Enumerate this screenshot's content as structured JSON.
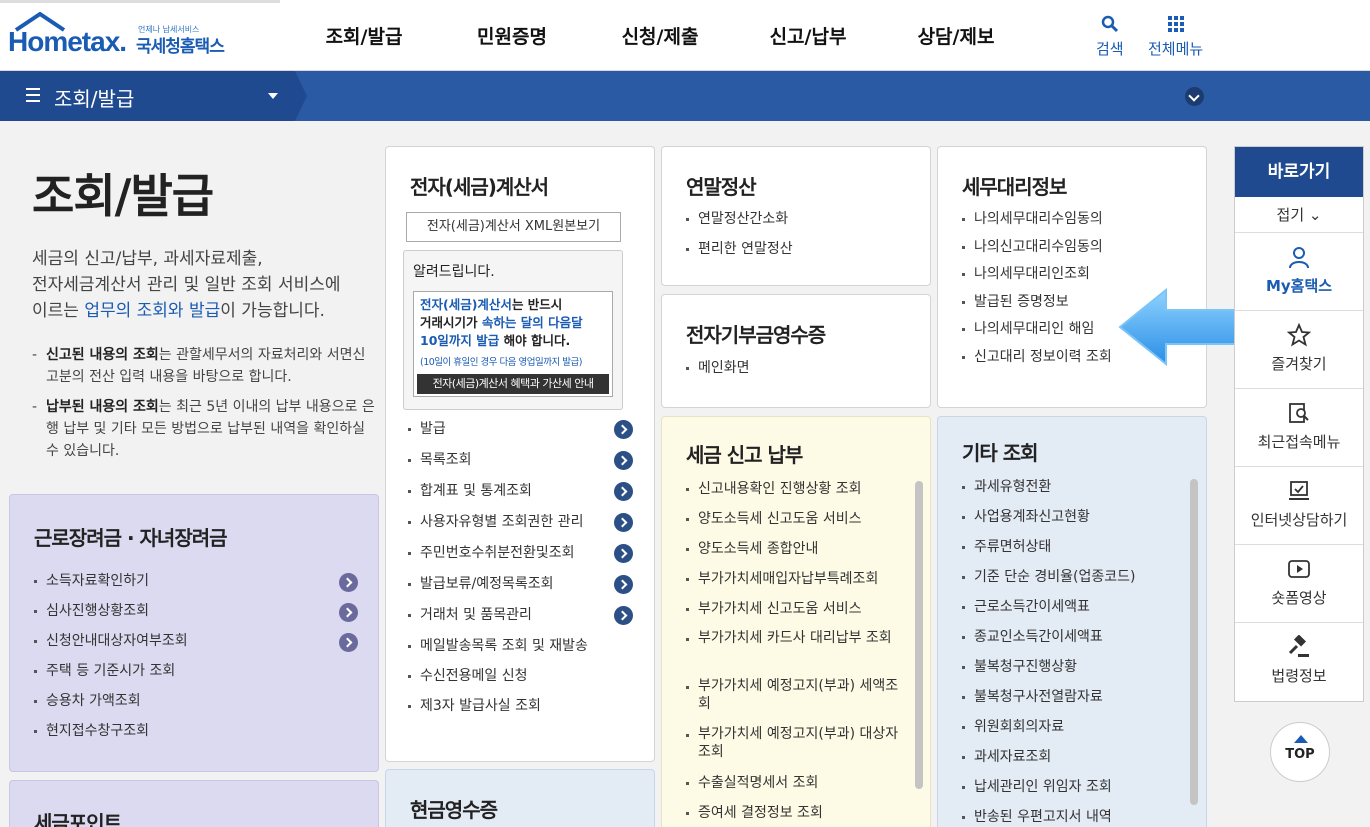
{
  "header": {
    "logo_main": "Hometax.",
    "logo_sub": "국세청홈택스",
    "logo_small": "언제나 납세서비스",
    "nav": [
      "조회/발급",
      "민원증명",
      "신청/제출",
      "신고/납부",
      "상담/제보"
    ],
    "search_label": "검색",
    "allmenu_label": "전체메뉴"
  },
  "bar": {
    "title": "조회/발급"
  },
  "intro": {
    "title": "조회/발급",
    "desc_1": "세금의 신고/납부, 과세자료제출,",
    "desc_2": "전자세금계산서 관리 및 일반 조회 서비스에",
    "desc_3_pre": "이르는 ",
    "desc_3_hl": "업무의 조회와 발급",
    "desc_3_post": "이 가능합니다.",
    "note1_b": "신고된 내용의 조회",
    "note1_t": "는 관할세무서의 자료처리와 서면신고분의 전산 입력 내용을 바탕으로 합니다.",
    "note2_b": "납부된 내용의 조회",
    "note2_t": "는 최근 5년 이내의 납부 내용으로 은행 납부 및 기타 모든 방법으로 납부된 내역을 확인하실 수 있습니다."
  },
  "card_incentive": {
    "title": "근로장려금 · 자녀장려금",
    "items": [
      "소득자료확인하기",
      "심사진행상황조회",
      "신청안내대상자여부조회",
      "주택 등 기준시가 조회",
      "승용차 가액조회",
      "현지접수창구조회"
    ]
  },
  "card_points": {
    "title": "세금포인트"
  },
  "card_einvoice": {
    "title": "전자(세금)계산서",
    "xml_button": "전자(세금)계산서 XML원본보기",
    "notice_title": "알려드립니다.",
    "notice_l1a": "전자(세금)계산서",
    "notice_l1b": "는 반드시",
    "notice_l2a": "거래시기가 ",
    "notice_l2b": "속하는 달의 다음달",
    "notice_l3a": "10일까지 발급",
    "notice_l3b": " 해야 합니다.",
    "notice_small": "(10일이 휴일인 경우 다음 영업일까지 발급)",
    "notice_bar": "전자(세금)계산서 혜택과 가산세 안내",
    "items": [
      "발급",
      "목록조회",
      "합계표 및 통계조회",
      "사용자유형별 조회권한 관리",
      "주민번호수취분전환및조회",
      "발급보류/예정목록조회",
      "거래처 및 품목관리",
      "메일발송목록 조회 및 재발송",
      "수신전용메일 신청",
      "제3자 발급사실 조회"
    ]
  },
  "card_cash": {
    "title": "현금영수증"
  },
  "card_yearend": {
    "title": "연말정산",
    "items": [
      "연말정산간소화",
      "편리한 연말정산"
    ]
  },
  "card_donation": {
    "title": "전자기부금영수증",
    "items": [
      "메인화면"
    ]
  },
  "card_tax": {
    "title": "세금 신고 납부",
    "items": [
      "신고내용확인 진행상황 조회",
      "양도소득세 신고도움 서비스",
      "양도소득세 종합안내",
      "부가가치세매입자납부특례조회",
      "부가가치세 신고도움 서비스",
      "부가가치세 카드사 대리납부 조회",
      "부가가치세 예정고지(부과) 세액조회",
      "부가가치세 예정고지(부과) 대상자 조회",
      "수출실적명세서 조회",
      "증여세 결정정보 조회"
    ]
  },
  "card_agent": {
    "title": "세무대리정보",
    "items": [
      "나의세무대리수임동의",
      "나의신고대리수임동의",
      "나의세무대리인조회",
      "발급된 증명정보",
      "나의세무대리인 해임",
      "신고대리 정보이력 조회"
    ]
  },
  "card_etc": {
    "title": "기타 조회",
    "items": [
      "과세유형전환",
      "사업용계좌신고현황",
      "주류면허상태",
      "기준 단순 경비율(업종코드)",
      "근로소득간이세액표",
      "종교인소득간이세액표",
      "불복청구진행상황",
      "불복청구사전열람자료",
      "위원회회의자료",
      "과세자료조회",
      "납세관리인 위임자 조회",
      "반송된 우편고지서 내역"
    ]
  },
  "quick": {
    "head": "바로가기",
    "fold": "접기",
    "items": [
      "My홈택스",
      "즐겨찾기",
      "최근접속메뉴",
      "인터넷상담하기",
      "숏폼영상",
      "법령정보"
    ],
    "top": "TOP"
  },
  "colors": {
    "primary": "#1f4a8f",
    "accent": "#1a5bb3",
    "arrow": "#3aa7f0"
  }
}
